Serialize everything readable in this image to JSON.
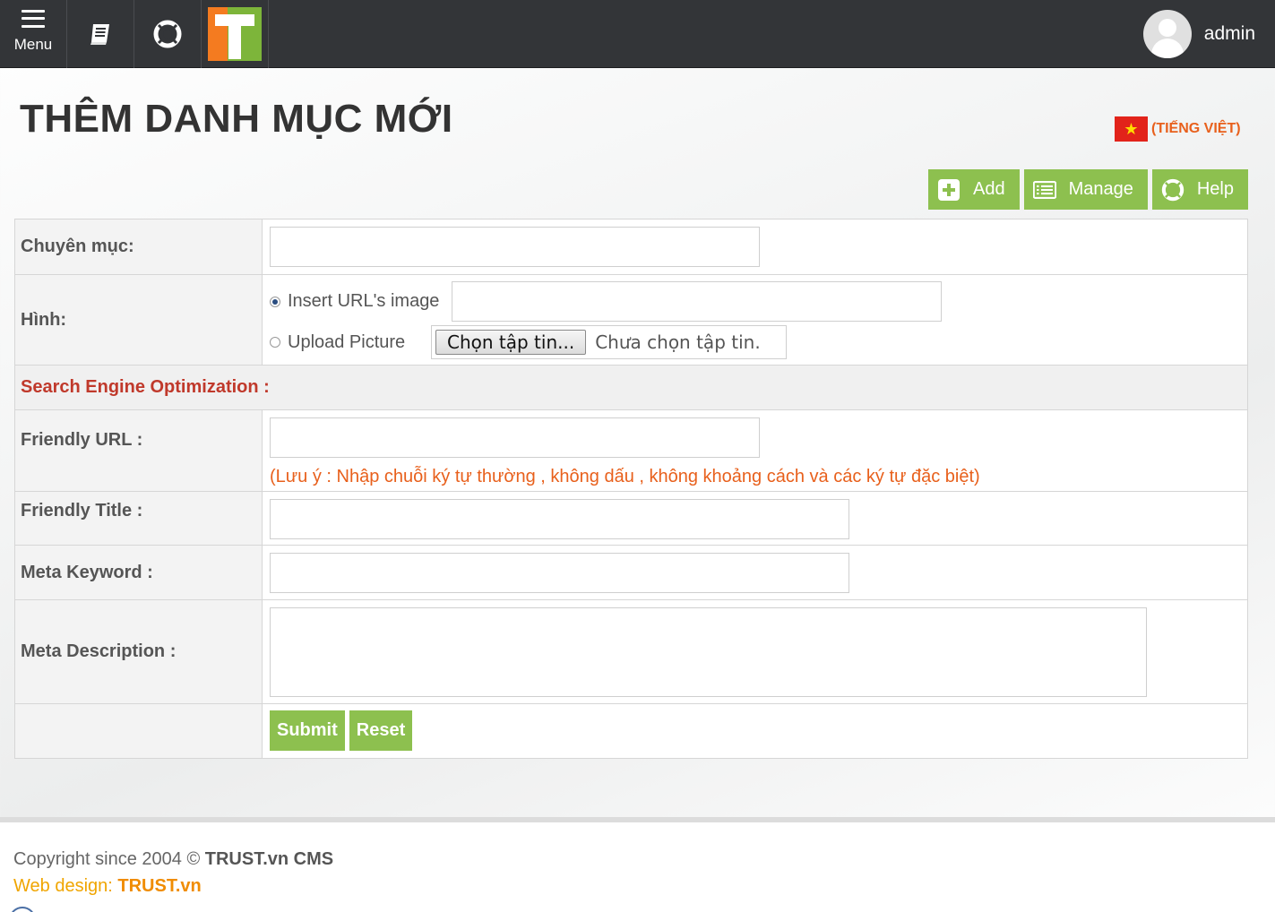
{
  "topbar": {
    "menu_label": "Menu",
    "user_name": "admin",
    "icons": [
      "menu-icon",
      "book-icon",
      "lifebuoy-icon",
      "trust-logo"
    ]
  },
  "page": {
    "title": "THÊM DANH MỤC MỚI",
    "language": "(TIẾNG VIỆT)"
  },
  "actions": {
    "add": "Add",
    "manage": "Manage",
    "help": "Help"
  },
  "form": {
    "category_label": "Chuyên mục:",
    "image_label": "Hình:",
    "insert_url_label": "Insert URL's image",
    "upload_label": "Upload Picture",
    "file_button": "Chọn tập tin...",
    "file_status": "Chưa chọn tập tin.",
    "seo_section": "Search Engine Optimization :",
    "friendly_url_label": "Friendly URL :",
    "friendly_url_note": "(Lưu ý : Nhập chuỗi ký tự thường , không dấu , không khoảng cách và các ký tự đặc biệt)",
    "friendly_title_label": "Friendly Title :",
    "meta_keyword_label": "Meta Keyword :",
    "meta_description_label": "Meta Description :",
    "submit": "Submit",
    "reset": "Reset"
  },
  "footer": {
    "copyright_prefix": "Copyright since 2004 © ",
    "copyright_brand": "TRUST.vn CMS",
    "design_prefix": "Web design: ",
    "design_brand": "TRUST.vn"
  },
  "colors": {
    "topbar": "#333538",
    "accent_green": "#8dc04f",
    "note_orange": "#e8601c",
    "section_red": "#c0392b"
  }
}
